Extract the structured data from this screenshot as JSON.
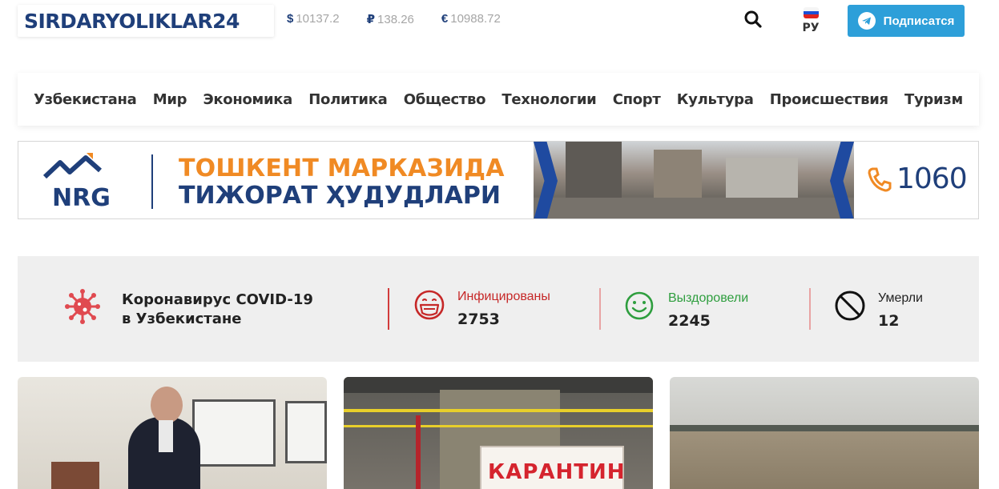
{
  "header": {
    "logo": "SIRDARYOLIKLAR24",
    "rates": [
      {
        "symbol": "$",
        "value": "10137.2"
      },
      {
        "symbol": "₽",
        "value": "138.26"
      },
      {
        "symbol": "€",
        "value": "10988.72"
      }
    ],
    "language": "РУ",
    "subscribe_label": "Подписатся",
    "colors": {
      "brand": "#1f3f7a",
      "subscribe": "#2d9fd9"
    }
  },
  "nav": {
    "items": [
      "Узбекистана",
      "Мир",
      "Экономика",
      "Политика",
      "Общество",
      "Технологии",
      "Спорт",
      "Культура",
      "Происшествия",
      "Туризм"
    ]
  },
  "banner": {
    "brand": "NRG",
    "line1": "ТОШКЕНТ МАРКАЗИДА",
    "line2": "ТИЖОРАТ ҲУДУДЛАРИ",
    "phone": "1060"
  },
  "covid": {
    "title_line1": "Коронавирус COVID-19",
    "title_line2": "в Узбекистане",
    "stats": [
      {
        "label": "Инфицированы",
        "value": "2753",
        "color": "#c62828",
        "icon": "masked-face-icon"
      },
      {
        "label": "Выздоровели",
        "value": "2245",
        "color": "#2e9e3e",
        "icon": "smiley-icon"
      },
      {
        "label": "Умерли",
        "value": "12",
        "color": "#222222",
        "icon": "prohibited-icon"
      }
    ]
  },
  "news": {
    "cards": [
      {
        "image": "news-photo"
      },
      {
        "image": "news-photo",
        "sign_text": "КАРАНТИН"
      },
      {
        "image": "news-photo"
      }
    ]
  }
}
